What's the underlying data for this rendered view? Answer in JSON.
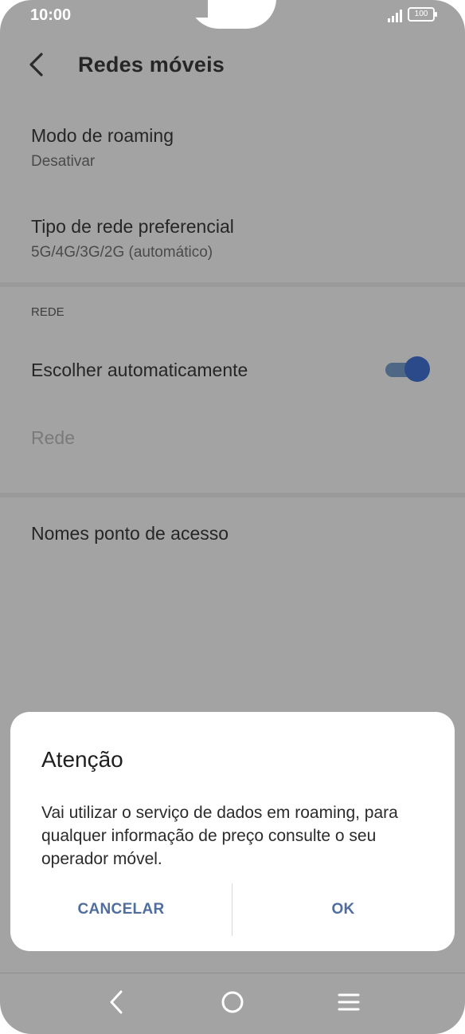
{
  "status_bar": {
    "time": "10:00",
    "battery": "100"
  },
  "header": {
    "title": "Redes móveis",
    "back_icon": "chevron-left-icon"
  },
  "settings": {
    "roaming": {
      "title": "Modo de roaming",
      "value": "Desativar"
    },
    "network_type": {
      "title": "Tipo de rede preferencial",
      "value": "5G/4G/3G/2G (automático)"
    },
    "section_label": "REDE",
    "auto_select": {
      "title": "Escolher automaticamente",
      "enabled": true
    },
    "network": {
      "title": "Rede"
    },
    "apn": {
      "title": "Nomes ponto de acesso"
    }
  },
  "dialog": {
    "title": "Atenção",
    "message": "Vai utilizar o serviço de dados em roaming, para qualquer informação de preço consulte o seu operador móvel.",
    "cancel_label": "CANCELAR",
    "ok_label": "OK"
  },
  "colors": {
    "accent": "#4f6e9e",
    "toggle_thumb": "#2a4a8a",
    "scrim": "#a3a3a3"
  },
  "nav_bar": {
    "back_icon": "nav-back-icon",
    "home_icon": "nav-home-icon",
    "menu_icon": "nav-menu-icon"
  }
}
